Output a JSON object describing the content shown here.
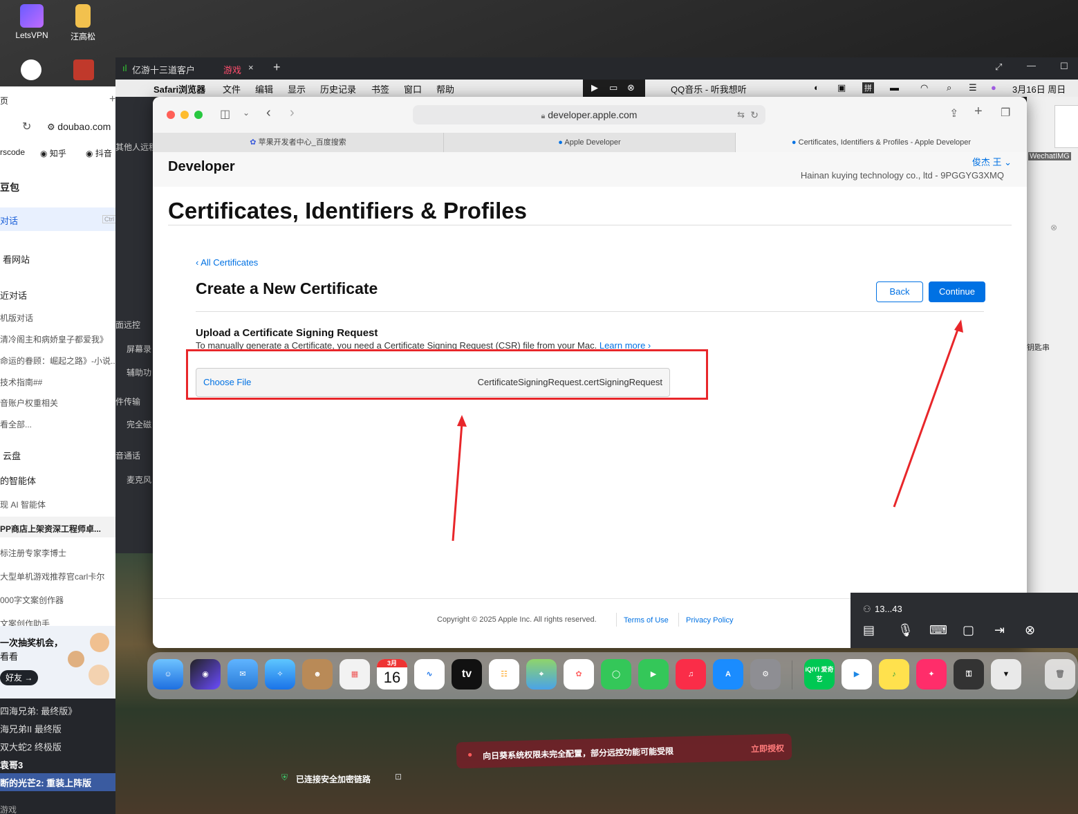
{
  "desktop": {
    "icons": [
      {
        "label": "LetsVPN"
      },
      {
        "label": "汪高松"
      }
    ]
  },
  "left_browser": {
    "url": "doubao.com",
    "bookmarks": [
      "rscode",
      "知乎",
      "抖音"
    ],
    "tab_label": "页",
    "items": [
      "豆包",
      "对话",
      "看网站",
      "近对话",
      "机版对话",
      "清冷阁主和病娇皇子都爱我》",
      "命运的眷顾：崛起之路》-小说...",
      "技术指南##",
      "音账户权重相关",
      "看全部...",
      "云盘",
      "的智能体",
      "现 AI 智能体",
      "PP商店上架资深工程师卓...",
      "标注册专家李博士",
      "大型单机游戏推荐官carl卡尔",
      "000字文案创作器",
      "文案创作助手"
    ],
    "promo_text": "一次抽奖机会，",
    "promo_sub": "看看",
    "promo_button": "好友 →",
    "shortcut_hint": "Ctrl"
  },
  "left_bottom_list": [
    "四海兄弟: 最终版》",
    "海兄弟II 最终版",
    "双大蛇2 终极版",
    "袁哥3",
    "断的光芒2: 重装上阵版",
    "游戏"
  ],
  "remote_client": {
    "title": "亿游十三道客户",
    "tab_badge": "游戏",
    "side_items": [
      "其他人远程",
      "面远控",
      "屏幕录",
      "辅助功",
      "件传输",
      "完全磁",
      "音通话",
      "麦克风"
    ]
  },
  "mac_menubar": {
    "items": [
      "Safari浏览器",
      "文件",
      "编辑",
      "显示",
      "历史记录",
      "书签",
      "窗口",
      "帮助"
    ],
    "now_playing": "QQ音乐 - 听我想听",
    "input_method": "拼",
    "date": "3月16日 周日"
  },
  "safari": {
    "url": "developer.apple.com",
    "tabs": [
      {
        "title": "苹果开发者中心_百度搜索"
      },
      {
        "title": "Apple Developer"
      },
      {
        "title": "Certificates, Identifiers & Profiles - Apple Developer"
      }
    ]
  },
  "page": {
    "brand": "Developer",
    "user_name": "俊杰 王 ⌄",
    "team": "Hainan kuying technology co., ltd - 9PGGYG3XMQ",
    "heading": "Certificates, Identifiers & Profiles",
    "back_link": "‹ All Certificates",
    "subheading": "Create a New Certificate",
    "back_button": "Back",
    "continue_button": "Continue",
    "section_title": "Upload a Certificate Signing Request",
    "section_desc": "To manually generate a Certificate, you need a Certificate Signing Request (CSR) file from your Mac.",
    "learn_more": "Learn more ›",
    "choose_file": "Choose File",
    "file_name": "CertificateSigningRequest.certSigningRequest",
    "copyright": "Copyright © 2025 Apple Inc. All rights reserved.",
    "terms": "Terms of Use",
    "privacy": "Privacy Policy"
  },
  "remote_panel": {
    "id": "13...43"
  },
  "dock": {
    "calendar_month": "3月",
    "calendar_day": "16",
    "tv_label": "tv",
    "iqiyi": "iQIYI 爱奇艺"
  },
  "right_strip": {
    "label": "WechatIMG",
    "side_text": "钥匙串"
  },
  "warning": {
    "text": "向日葵系统权限未完全配置，部分远控功能可能受限",
    "action": "立即授权"
  },
  "secure_connection": "已连接安全加密链路",
  "colors": {
    "apple_blue": "#0071e3",
    "annotation_red": "#e8262a"
  }
}
